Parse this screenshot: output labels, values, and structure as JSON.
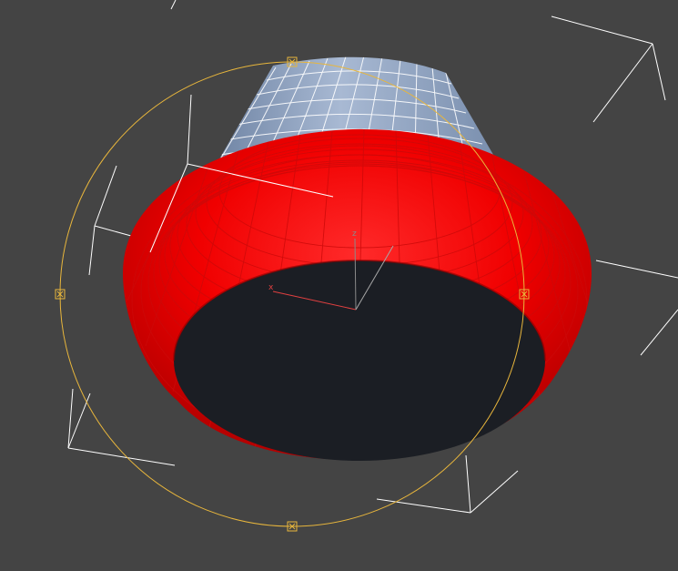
{
  "viewport": {
    "background": "#444444"
  },
  "colors": {
    "torus": "#ff0000",
    "torus_dark": "#a80000",
    "torus_grid": "#d11010",
    "cone": "#8ea2bf",
    "cone_grid": "#ffffff",
    "hole": "#1b1e24",
    "gizmo": "#e8b63c",
    "bounding_box": "#ffffff",
    "axis_x": "#e04040",
    "axis_z": "#8a8a8a"
  },
  "gizmo": {
    "axis_x_label": "x",
    "axis_z_label": "z"
  },
  "icons": {
    "gizmo_handle": "gizmo-handle-icon",
    "pivot": "pivot-axis-icon"
  }
}
